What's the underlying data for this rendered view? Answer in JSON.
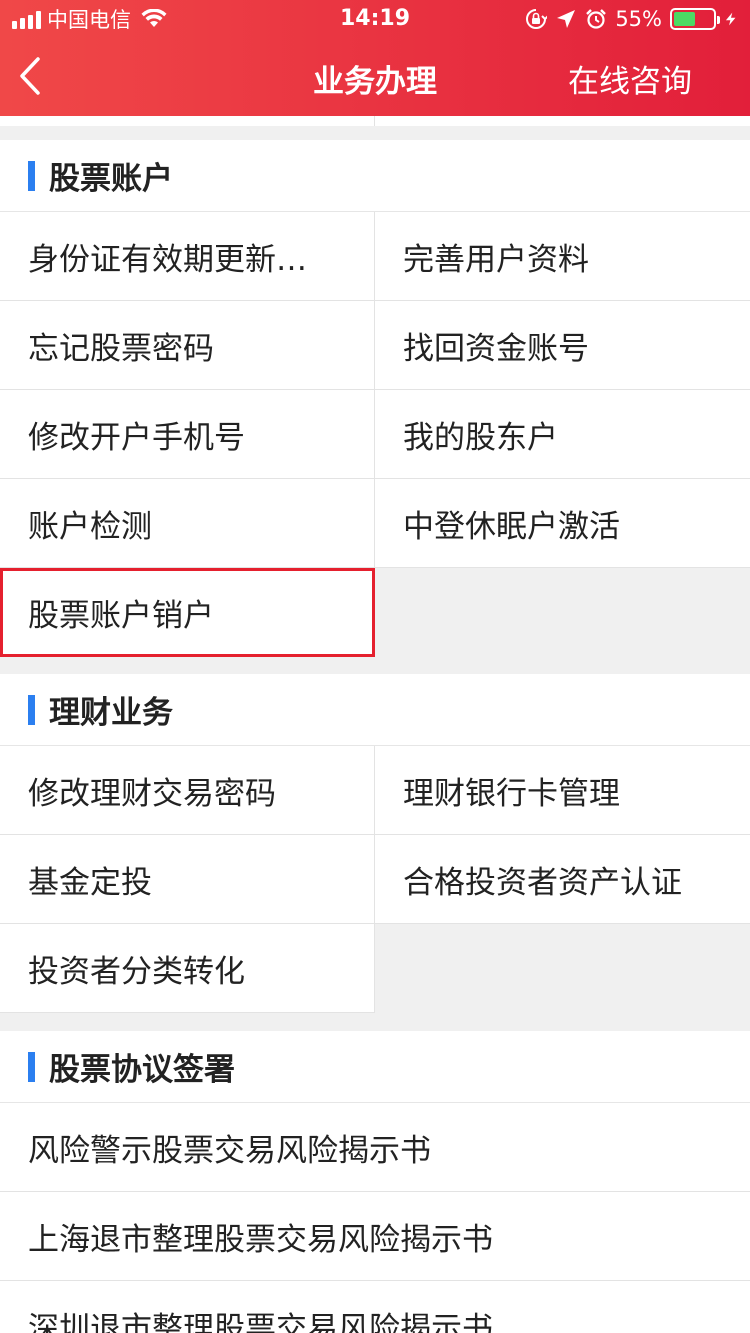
{
  "status": {
    "carrier": "中国电信",
    "time": "14:19",
    "battery_pct": "55%",
    "battery_level": 0.55,
    "battery_color": "#4cd964"
  },
  "nav": {
    "title": "业务办理",
    "right_action": "在线咨询",
    "accent_start": "#f04848",
    "accent_end": "#e21f3a"
  },
  "sections": [
    {
      "title": "股票账户",
      "items": [
        "身份证有效期更新…",
        "完善用户资料",
        "忘记股票密码",
        "找回资金账号",
        "修改开户手机号",
        "我的股东户",
        "账户检测",
        "中登休眠户激活",
        "股票账户销户"
      ]
    },
    {
      "title": "理财业务",
      "items": [
        "修改理财交易密码",
        "理财银行卡管理",
        "基金定投",
        "合格投资者资产认证",
        "投资者分类转化"
      ]
    },
    {
      "title": "股票协议签署",
      "items": [
        "风险警示股票交易风险揭示书",
        "上海退市整理股票交易风险揭示书",
        "深圳退市整理股票交易风险揭示书"
      ]
    }
  ],
  "highlight_color": "#e5202e",
  "section_bar_color": "#2b7ff0"
}
